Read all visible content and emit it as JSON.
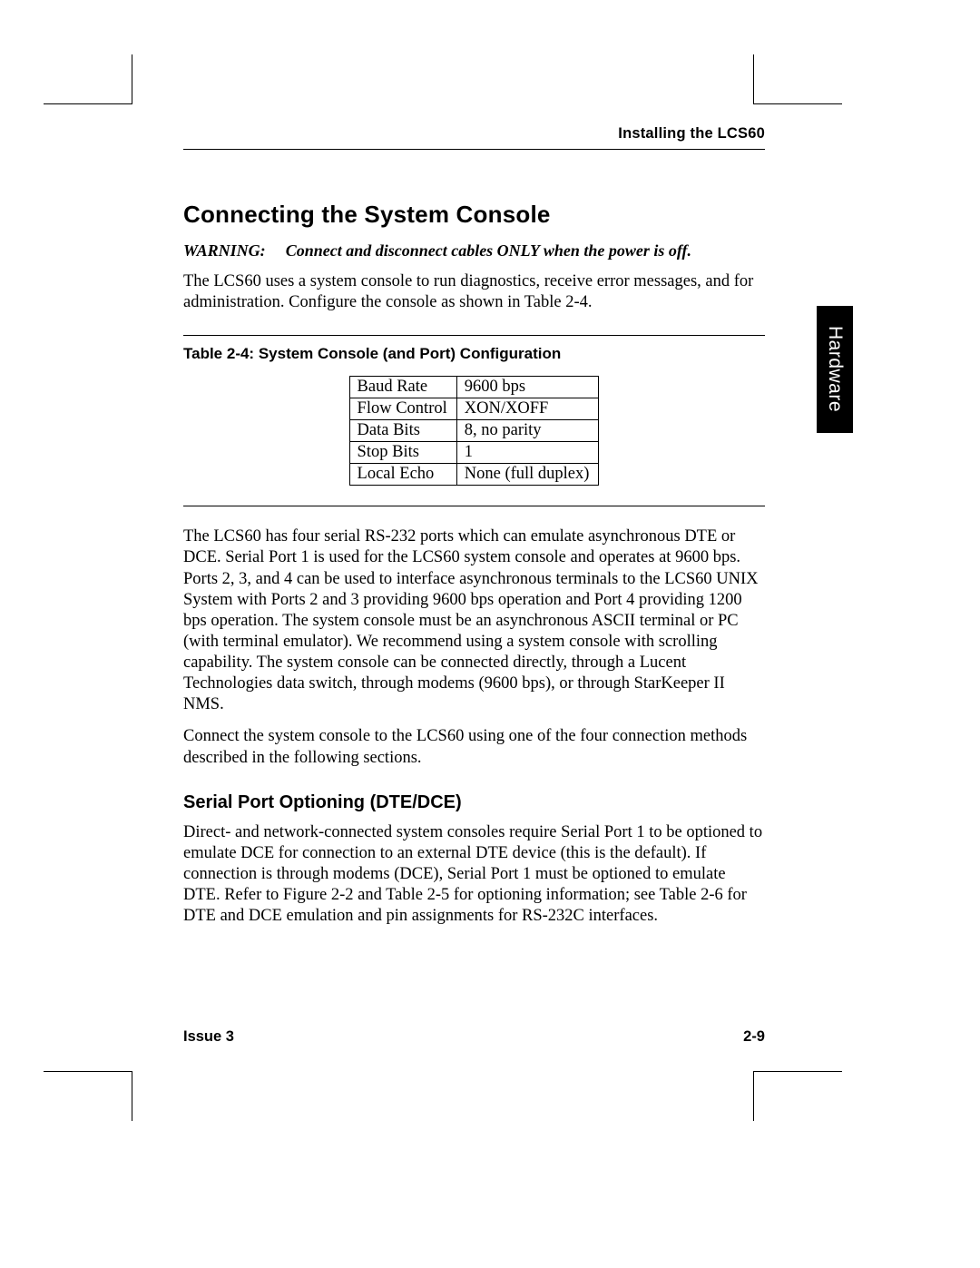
{
  "running_head": "Installing the LCS60",
  "section_title": "Connecting the System Console",
  "warning_label": "WARNING:",
  "warning_text": "Connect and disconnect cables ONLY when the power is off.",
  "intro_para": "The LCS60 uses a system console to run diagnostics, receive error messages, and for administration. Configure the console as shown in Table 2-4.",
  "table_caption": "Table 2-4:  System Console (and Port) Configuration",
  "config_rows": [
    {
      "param": "Baud Rate",
      "value": "9600 bps"
    },
    {
      "param": "Flow Control",
      "value": "XON/XOFF"
    },
    {
      "param": "Data Bits",
      "value": "8, no parity"
    },
    {
      "param": "Stop Bits",
      "value": "1"
    },
    {
      "param": "Local Echo",
      "value": "None (full duplex)"
    }
  ],
  "para_ports": "The LCS60 has four serial RS-232 ports which can emulate asynchronous DTE or DCE. Serial Port 1 is used for the LCS60 system console and operates at 9600 bps. Ports 2, 3, and 4 can be used to interface asynchronous terminals to the LCS60 UNIX System with Ports 2 and 3 providing 9600 bps operation and Port 4 providing 1200 bps operation. The system console must be an asynchronous ASCII terminal or PC (with terminal emulator). We recommend using a system console with scrolling capability. The system console can be connected directly, through a Lucent Technologies data switch, through modems (9600 bps), or through StarKeeper II NMS.",
  "para_connect": "Connect the system console to the LCS60 using one of the four connection methods described in the following sections.",
  "sub_title": "Serial Port Optioning (DTE/DCE)",
  "para_optioning": "Direct- and network-connected system consoles require Serial Port 1 to be optioned to emulate DCE for connection to an external DTE device (this is the default). If connection is through modems (DCE), Serial Port 1 must be optioned to emulate DTE. Refer to Figure 2-2 and Table 2-5 for optioning information; see Table 2-6 for DTE and DCE emulation and pin assignments for RS-232C interfaces.",
  "footer_left": "Issue 3",
  "footer_right": "2-9",
  "side_tab": "Hardware"
}
